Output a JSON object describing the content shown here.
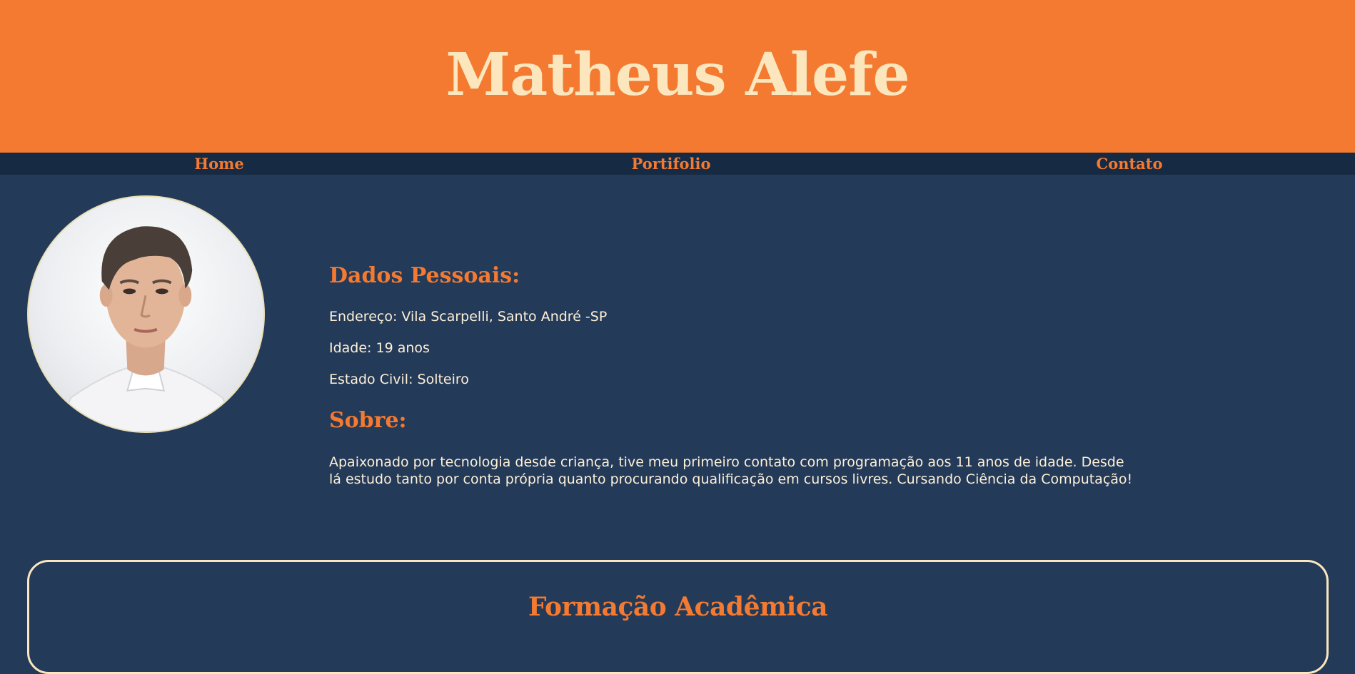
{
  "header": {
    "title": "Matheus Alefe"
  },
  "nav": {
    "items": [
      {
        "label": "Home"
      },
      {
        "label": "Portifolio"
      },
      {
        "label": "Contato"
      }
    ]
  },
  "profile": {
    "photo_alt": "profile-photo"
  },
  "personal": {
    "heading": "Dados Pessoais:",
    "address": "Endereço: Vila Scarpelli, Santo André -SP",
    "age": "Idade: 19 anos",
    "marital_status": "Estado Civil: Solteiro"
  },
  "about": {
    "heading": "Sobre:",
    "text": "Apaixonado por tecnologia desde criança, tive meu primeiro contato com programação aos 11 anos de idade. Desde lá estudo tanto por conta própria quanto procurando qualificação em cursos livres. Cursando Ciência da Computação!"
  },
  "education": {
    "heading": "Formação Acadêmica"
  },
  "colors": {
    "header_bg": "#f37a30",
    "title_text": "#fbe6bd",
    "nav_bg": "#172a43",
    "page_bg": "#243a59",
    "accent": "#f37a30",
    "body_text": "#fdf0d8"
  }
}
